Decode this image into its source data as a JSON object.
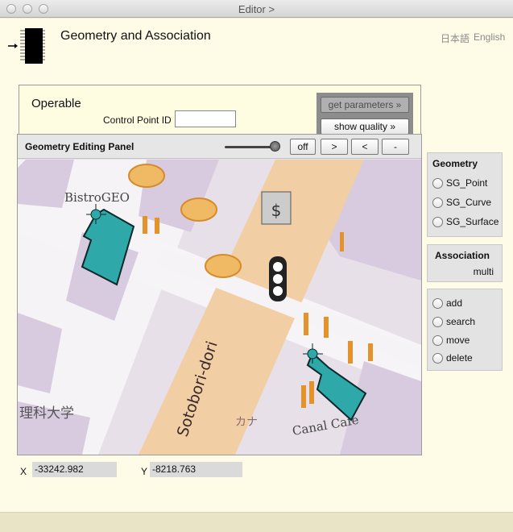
{
  "window": {
    "title": "Editor >"
  },
  "header": {
    "title": "Geometry and Association",
    "languages": [
      "日本語",
      "English"
    ]
  },
  "operable": {
    "label": "Operable",
    "control_point_label": "Control Point ID",
    "control_point_value": "",
    "get_parameters_label": "get parameters »",
    "show_quality_label": "show quality »"
  },
  "panel": {
    "title": "Geometry Editing Panel",
    "buttons": [
      "off",
      ">",
      "<",
      "-"
    ],
    "map_labels": {
      "bistro": "BistroGEO",
      "canal": "Canal Cafe",
      "street": "Sotobori-dori",
      "kanji_univ": "理科大学",
      "kana": "カナ"
    }
  },
  "coords": {
    "x_label": "X",
    "x_value": "-33242.982",
    "y_label": "Y",
    "y_value": "-8218.763"
  },
  "geometry": {
    "title": "Geometry",
    "options": [
      "SG_Point",
      "SG_Curve",
      "SG_Surface"
    ]
  },
  "association": {
    "title": "Association",
    "value": "multi"
  },
  "actions": {
    "options": [
      "add",
      "search",
      "move",
      "delete"
    ]
  },
  "colors": {
    "accent": "#2ea8a8",
    "road": "#f3cfa6",
    "block": "#d9cce0"
  }
}
